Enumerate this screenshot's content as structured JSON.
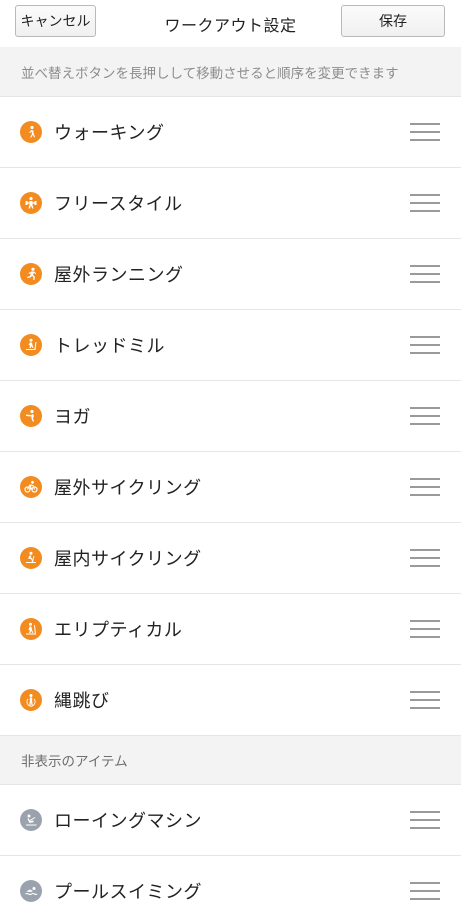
{
  "header": {
    "cancel_label": "キャンセル",
    "title": "ワークアウト設定",
    "save_label": "保存"
  },
  "hint": "並べ替えボタンを長押しして移動させると順序を変更できます",
  "visible_items": [
    {
      "label": "ウォーキング",
      "icon": "walking-icon"
    },
    {
      "label": "フリースタイル",
      "icon": "freestyle-icon"
    },
    {
      "label": "屋外ランニング",
      "icon": "running-icon"
    },
    {
      "label": "トレッドミル",
      "icon": "treadmill-icon"
    },
    {
      "label": "ヨガ",
      "icon": "yoga-icon"
    },
    {
      "label": "屋外サイクリング",
      "icon": "cycling-icon"
    },
    {
      "label": "屋内サイクリング",
      "icon": "indoor-cycling-icon"
    },
    {
      "label": "エリプティカル",
      "icon": "elliptical-icon"
    },
    {
      "label": "縄跳び",
      "icon": "jump-rope-icon"
    }
  ],
  "hidden_section_title": "非表示のアイテム",
  "hidden_items": [
    {
      "label": "ローイングマシン",
      "icon": "rowing-icon"
    },
    {
      "label": "プールスイミング",
      "icon": "swimming-icon"
    }
  ],
  "colors": {
    "active_icon": "#f28c21",
    "inactive_icon": "#9aa3ad"
  }
}
